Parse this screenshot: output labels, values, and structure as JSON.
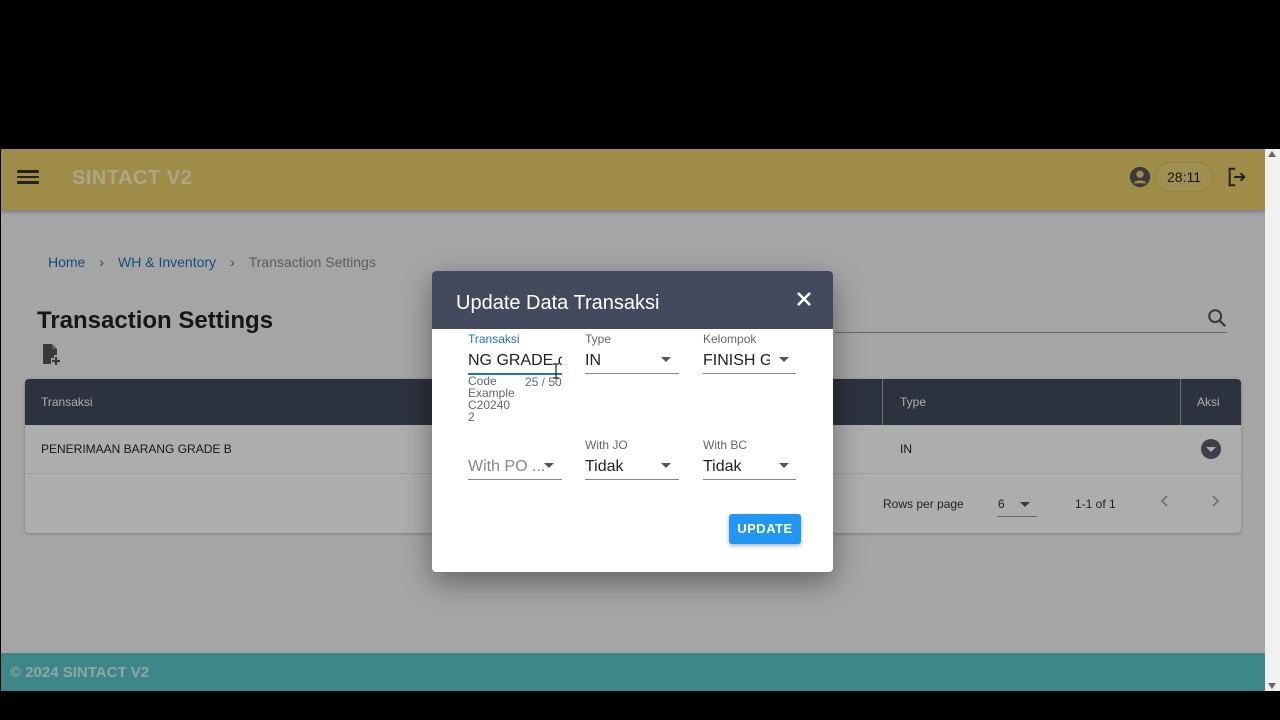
{
  "app": {
    "title": "SINTACT V2",
    "timer": "28:11",
    "footer": "© 2024 SINTACT V2"
  },
  "breadcrumb": {
    "home": "Home",
    "section": "WH & Inventory",
    "current": "Transaction Settings",
    "separator": "›"
  },
  "page": {
    "title": "Transaction Settings"
  },
  "table": {
    "headers": {
      "transaksi": "Transaksi",
      "type": "Type",
      "aksi": "Aksi"
    },
    "rows": [
      {
        "transaksi": "PENERIMAAN BARANG GRADE B",
        "type": "IN"
      }
    ],
    "rows_per_page_label": "Rows per page",
    "rows_per_page": "6",
    "page_range": "1-1 of 1"
  },
  "dialog": {
    "title": "Update Data Transaksi",
    "fields": {
      "transaksi": {
        "label": "Transaksi",
        "value": "NG GRADE c",
        "hint": "Code Example C20240 2",
        "counter": "25 / 50"
      },
      "type": {
        "label": "Type",
        "value": "IN"
      },
      "kelompok": {
        "label": "Kelompok",
        "value": "FINISH G"
      },
      "with_po": {
        "placeholder": "With PO ..."
      },
      "with_jo": {
        "label": "With JO",
        "value": "Tidak"
      },
      "with_bc": {
        "label": "With BC",
        "value": "Tidak"
      }
    },
    "update_label": "UPDATE"
  },
  "colors": {
    "appbar": "#e9cf6b",
    "header": "#434a5e",
    "footer": "#5bc7c9",
    "primary": "#2196f3",
    "link": "#1e73be"
  },
  "icons": [
    "menu-icon",
    "account-icon",
    "logout-icon",
    "add-file-icon",
    "search-icon",
    "close-icon",
    "chevron-down-icon",
    "chevron-left-icon",
    "chevron-right-icon"
  ]
}
